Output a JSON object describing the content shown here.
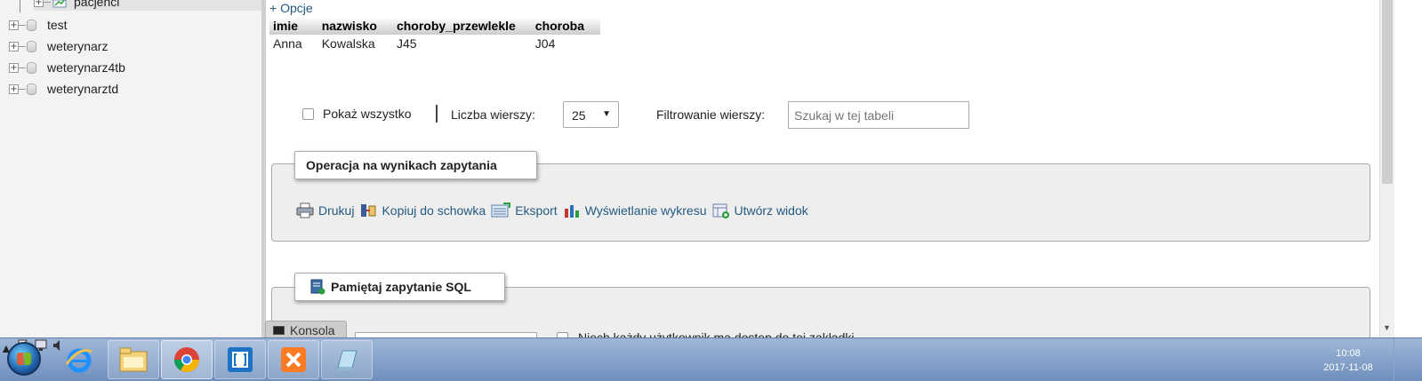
{
  "nav": {
    "items": [
      {
        "label": "pacjenci",
        "type": "table"
      },
      {
        "label": "test",
        "type": "database"
      },
      {
        "label": "weterynarz",
        "type": "database"
      },
      {
        "label": "weterynarz4tb",
        "type": "database"
      },
      {
        "label": "weterynarztd",
        "type": "database"
      }
    ]
  },
  "main": {
    "opcje": "+ Opcje",
    "table": {
      "headers": [
        "imie",
        "nazwisko",
        "choroby_przewlekle",
        "choroba"
      ],
      "rows": [
        [
          "Anna",
          "Kowalska",
          "J45",
          "J04"
        ]
      ]
    },
    "controls": {
      "show_all_label": "Pokaż wszystko",
      "rows_label": "Liczba wierszy:",
      "rows_value": "25",
      "filter_label": "Filtrowanie wierszy:",
      "search_placeholder": "Szukaj w tej tabeli"
    },
    "query_ops": {
      "legend": "Operacja na wynikach zapytania",
      "actions": [
        "Drukuj",
        "Kopiuj do schowka",
        "Eksport",
        "Wyświetlanie wykresu",
        "Utwórz widok"
      ]
    },
    "bookmark": {
      "legend": "Pamiętaj zapytanie SQL",
      "share_label": "Niech każdy użytkownik ma dostęp do tej zakładki"
    },
    "konsola": "Konsola"
  },
  "taskbar": {
    "apps": [
      "ie-icon",
      "file-explorer-icon",
      "chrome-icon",
      "brackets-icon",
      "xampp-icon",
      "notepad-icon"
    ],
    "clock_time": "10:08",
    "clock_date": "2017-11-08"
  }
}
